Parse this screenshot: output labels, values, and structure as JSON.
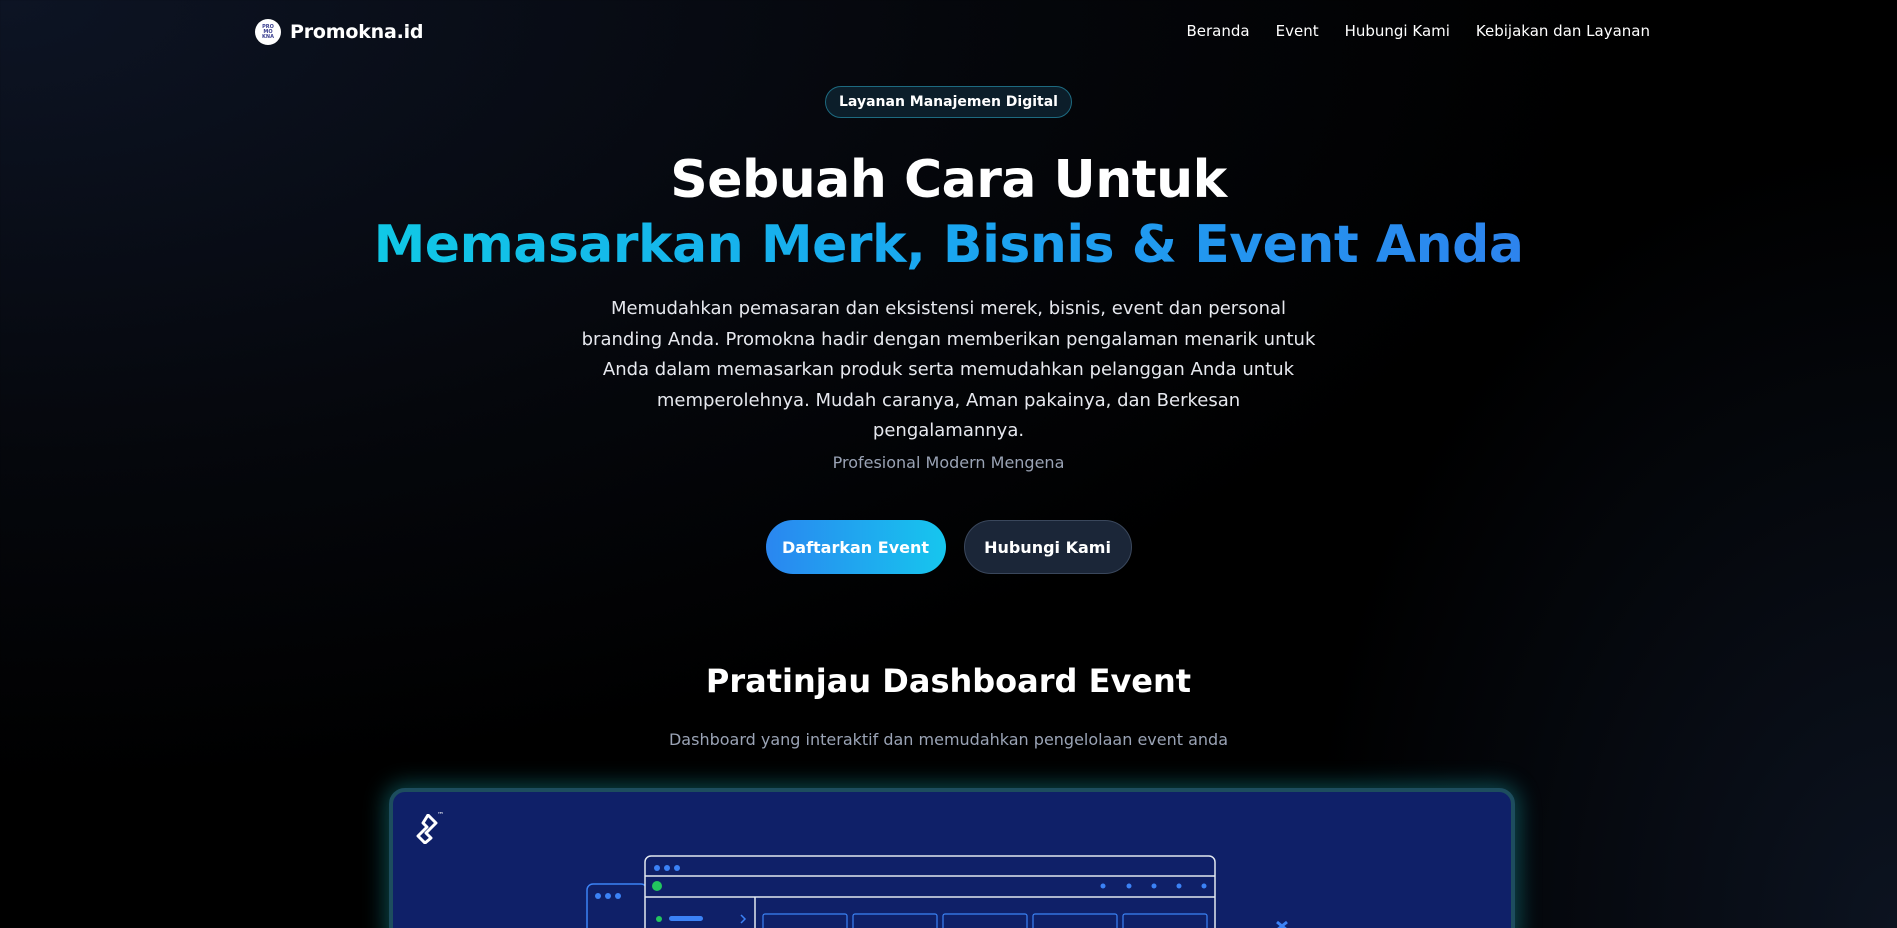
{
  "nav": {
    "brand": "Promokna.id",
    "brand_logo_text": [
      "PRO",
      "MO",
      "KNA"
    ],
    "links": [
      "Beranda",
      "Event",
      "Hubungi Kami",
      "Kebijakan dan Layanan"
    ]
  },
  "hero": {
    "badge": "Layanan Manajemen Digital",
    "title_line1": "Sebuah Cara Untuk",
    "title_line2": "Memasarkan Merk, Bisnis & Event Anda",
    "description": "Memudahkan pemasaran dan eksistensi merek, bisnis, event dan personal branding Anda. Promokna hadir dengan memberikan pengalaman menarik untuk Anda dalam memasarkan produk serta memudahkan pelanggan Anda untuk memperolehnya. Mudah caranya, Aman pakainya, dan Berkesan pengalamannya.",
    "tagline": "Profesional Modern Mengena",
    "primary_button": "Daftarkan Event",
    "secondary_button": "Hubungi Kami"
  },
  "preview_section": {
    "title": "Pratinjau Dashboard Event",
    "subtitle": "Dashboard yang interaktif dan memudahkan pengelolaan event anda",
    "logo_icon": "toptal-logo-icon",
    "trademark": "™"
  },
  "colors": {
    "accent_cyan": "#10c8e6",
    "accent_blue": "#2d84ee",
    "preview_bg": "#0f2068",
    "secondary_button_bg": "#1b2638"
  }
}
